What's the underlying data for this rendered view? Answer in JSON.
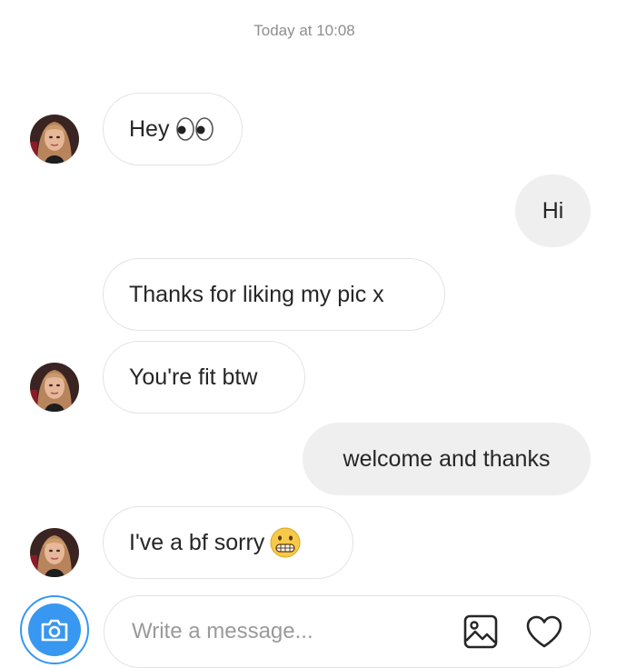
{
  "header": {
    "timestamp": "Today at 10:08"
  },
  "messages": [
    {
      "direction": "incoming",
      "text": "Hey",
      "emoji": "eyes-emoji",
      "avatar": true
    },
    {
      "direction": "outgoing",
      "text": "Hi"
    },
    {
      "direction": "incoming",
      "text": "Thanks for liking my pic x",
      "avatar": false
    },
    {
      "direction": "incoming",
      "text": "You're fit btw",
      "avatar": true
    },
    {
      "direction": "outgoing",
      "text": "welcome and thanks"
    },
    {
      "direction": "incoming",
      "text": "I've a bf sorry",
      "emoji": "grimacing-face-emoji",
      "avatar": true
    }
  ],
  "composer": {
    "placeholder": "Write a message...",
    "value": "",
    "icons": [
      "camera-icon",
      "gallery-icon",
      "heart-icon"
    ]
  },
  "colors": {
    "accent": "#3897f0",
    "incoming_border": "#e3e3e3",
    "outgoing_bg": "#efefef",
    "muted_text": "#8e8e8e"
  }
}
